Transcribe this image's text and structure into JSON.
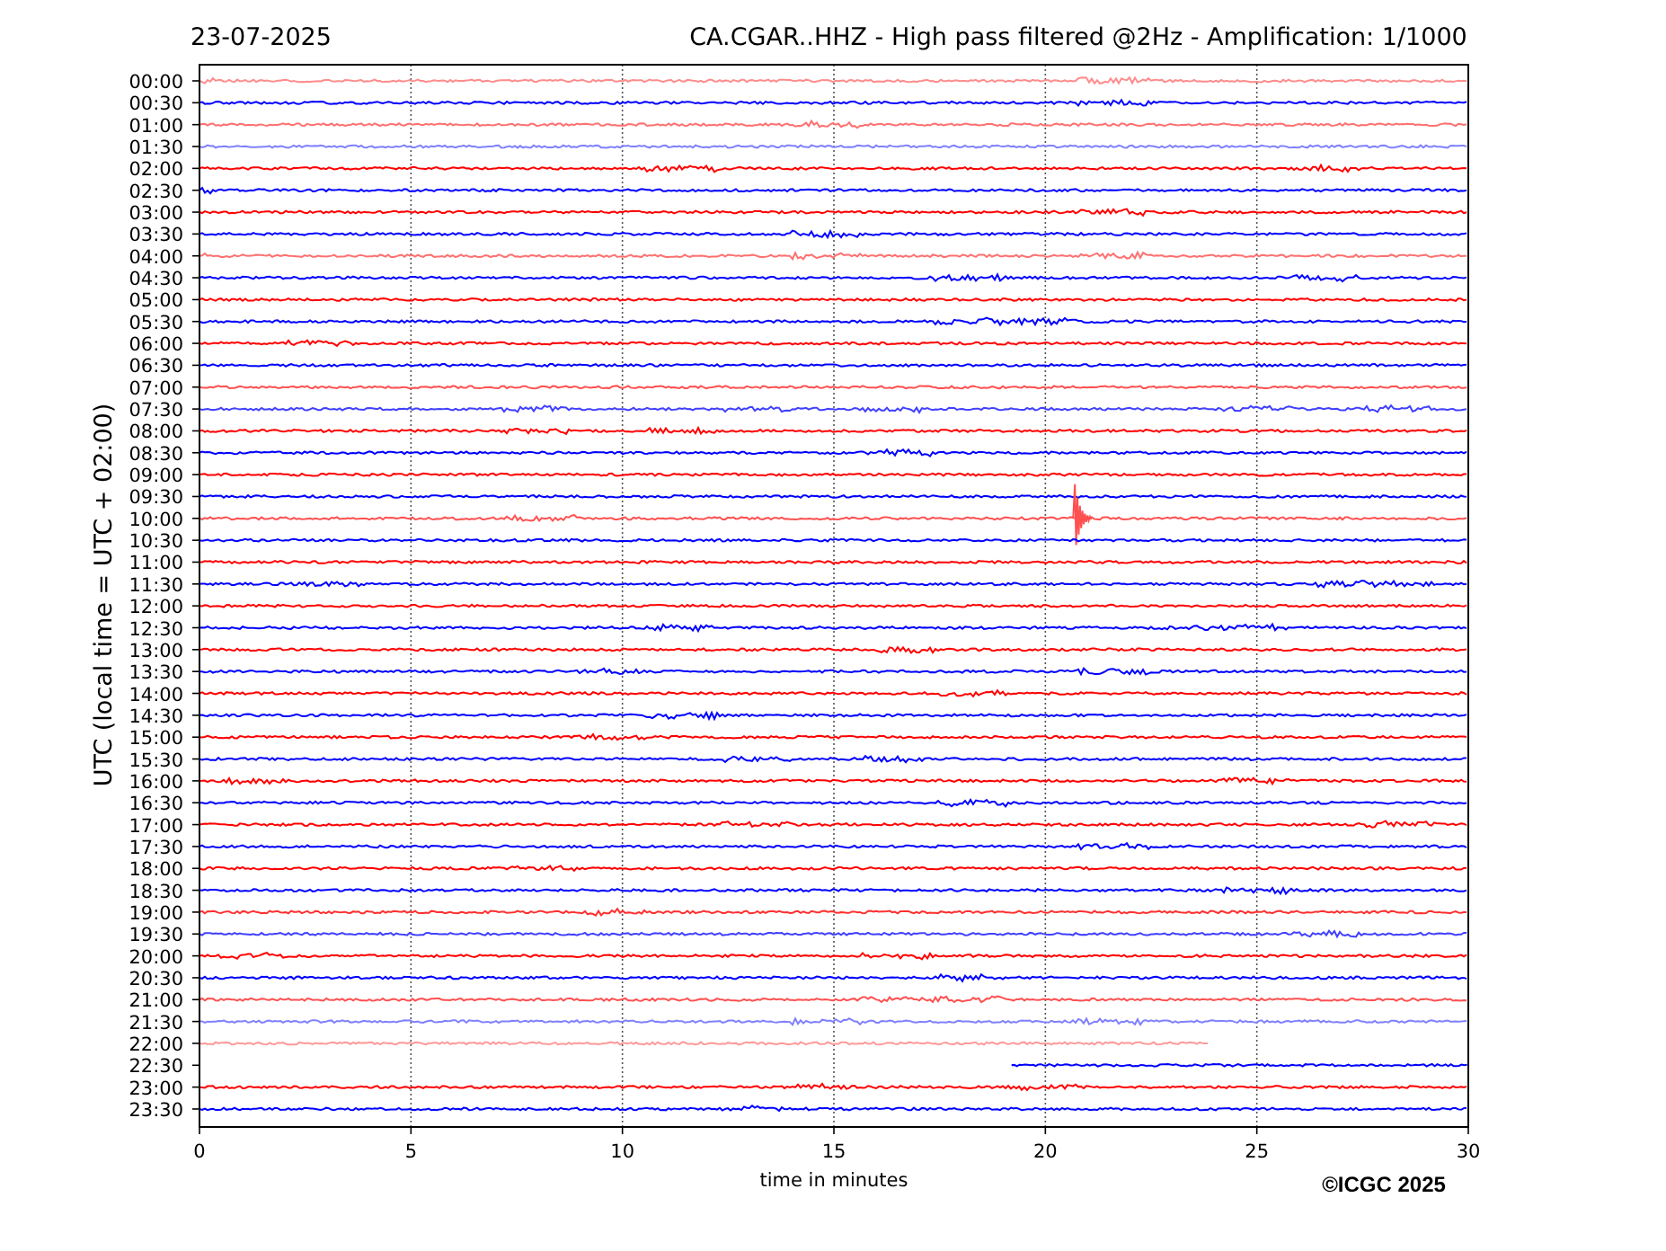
{
  "header": {
    "date": "23-07-2025",
    "title": "CA.CGAR..HHZ - High pass filtered @2Hz - Amplification: 1/1000"
  },
  "plot": {
    "ylabel": "UTC (local time = UTC + 02:00)",
    "xlabel": "time in minutes",
    "xticks": [
      "0",
      "5",
      "10",
      "15",
      "20",
      "25",
      "30"
    ],
    "rows": [
      {
        "label": "00:00",
        "color": "#ff8c8c",
        "kind": "noise"
      },
      {
        "label": "00:30",
        "color": "#0000ff",
        "kind": "noise"
      },
      {
        "label": "01:00",
        "color": "#ff7070",
        "kind": "noise"
      },
      {
        "label": "01:30",
        "color": "#8080ff",
        "kind": "noise"
      },
      {
        "label": "02:00",
        "color": "#ff0000",
        "kind": "noise"
      },
      {
        "label": "02:30",
        "color": "#0000ff",
        "kind": "noise"
      },
      {
        "label": "03:00",
        "color": "#ff0000",
        "kind": "noise"
      },
      {
        "label": "03:30",
        "color": "#0000ff",
        "kind": "noise"
      },
      {
        "label": "04:00",
        "color": "#ff7070",
        "kind": "noise"
      },
      {
        "label": "04:30",
        "color": "#0000ff",
        "kind": "noise"
      },
      {
        "label": "05:00",
        "color": "#ff0000",
        "kind": "noise"
      },
      {
        "label": "05:30",
        "color": "#0000ff",
        "kind": "noise"
      },
      {
        "label": "06:00",
        "color": "#ff0000",
        "kind": "noise"
      },
      {
        "label": "06:30",
        "color": "#0000ff",
        "kind": "noise"
      },
      {
        "label": "07:00",
        "color": "#ff5050",
        "kind": "noise"
      },
      {
        "label": "07:30",
        "color": "#4040ff",
        "kind": "noise"
      },
      {
        "label": "08:00",
        "color": "#ff0000",
        "kind": "noise"
      },
      {
        "label": "08:30",
        "color": "#0000ff",
        "kind": "noise"
      },
      {
        "label": "09:00",
        "color": "#ff0000",
        "kind": "noise"
      },
      {
        "label": "09:30",
        "color": "#0000ff",
        "kind": "noise"
      },
      {
        "label": "10:00",
        "color": "#ff5050",
        "kind": "event"
      },
      {
        "label": "10:30",
        "color": "#0000ff",
        "kind": "noise"
      },
      {
        "label": "11:00",
        "color": "#ff0000",
        "kind": "noise"
      },
      {
        "label": "11:30",
        "color": "#0000ff",
        "kind": "noise"
      },
      {
        "label": "12:00",
        "color": "#ff0000",
        "kind": "noise"
      },
      {
        "label": "12:30",
        "color": "#0000ff",
        "kind": "noise"
      },
      {
        "label": "13:00",
        "color": "#ff0000",
        "kind": "noise"
      },
      {
        "label": "13:30",
        "color": "#0000ff",
        "kind": "noise"
      },
      {
        "label": "14:00",
        "color": "#ff0000",
        "kind": "noise"
      },
      {
        "label": "14:30",
        "color": "#0000ff",
        "kind": "noise"
      },
      {
        "label": "15:00",
        "color": "#ff0000",
        "kind": "noise"
      },
      {
        "label": "15:30",
        "color": "#0000ff",
        "kind": "noise"
      },
      {
        "label": "16:00",
        "color": "#ff0000",
        "kind": "noise"
      },
      {
        "label": "16:30",
        "color": "#0000ff",
        "kind": "noise"
      },
      {
        "label": "17:00",
        "color": "#ff0000",
        "kind": "noise"
      },
      {
        "label": "17:30",
        "color": "#0000ff",
        "kind": "noise"
      },
      {
        "label": "18:00",
        "color": "#ff0000",
        "kind": "noise"
      },
      {
        "label": "18:30",
        "color": "#0000ff",
        "kind": "noise"
      },
      {
        "label": "19:00",
        "color": "#ff3030",
        "kind": "noise"
      },
      {
        "label": "19:30",
        "color": "#4040ff",
        "kind": "noise"
      },
      {
        "label": "20:00",
        "color": "#ff0000",
        "kind": "noise"
      },
      {
        "label": "20:30",
        "color": "#0000ff",
        "kind": "noise"
      },
      {
        "label": "21:00",
        "color": "#ff5050",
        "kind": "noise"
      },
      {
        "label": "21:30",
        "color": "#8080ff",
        "kind": "noise"
      },
      {
        "label": "22:00",
        "color": "#ff9999",
        "kind": "ends_early"
      },
      {
        "label": "22:30",
        "color": "#0000ff",
        "kind": "starts_late"
      },
      {
        "label": "23:00",
        "color": "#ff0000",
        "kind": "noise"
      },
      {
        "label": "23:30",
        "color": "#0000ff",
        "kind": "noise"
      }
    ]
  },
  "footer": {
    "copyright": "©ICGC 2025"
  }
}
